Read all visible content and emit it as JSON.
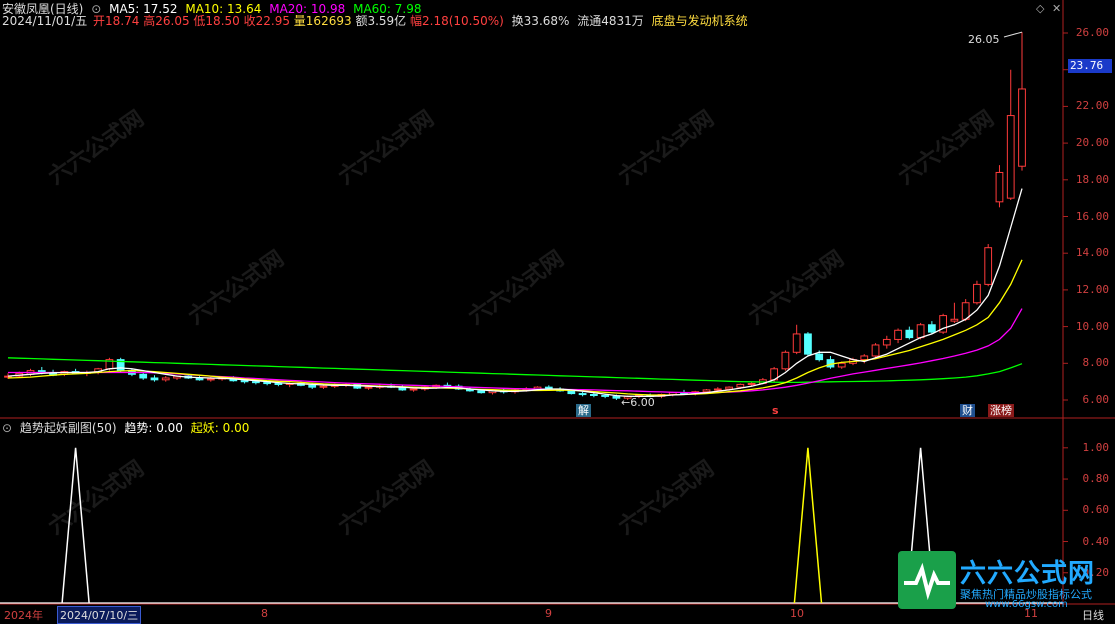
{
  "header": {
    "stock_name": "安徽凤凰(日线)",
    "ma5": "MA5: 17.52",
    "ma10": "MA10: 13.64",
    "ma20": "MA20: 10.98",
    "ma60": "MA60: 7.98",
    "date": "2024/11/01/五",
    "open": "开18.74",
    "high": "高26.05",
    "low": "低18.50",
    "close": "收22.95",
    "volume": "量162693",
    "amount": "额3.59亿",
    "change": "幅2.18(10.50%)",
    "turnover": "换33.68%",
    "float": "流通4831万",
    "system": "底盘与发动机系统"
  },
  "subchart_header": {
    "name": "趋势起妖副图(50)",
    "trend": "趋势: 0.00",
    "qiyao": "起妖: 0.00"
  },
  "price_axis": [
    "26.00",
    "24.00",
    "22.00",
    "20.00",
    "18.00",
    "16.00",
    "14.00",
    "12.00",
    "10.00",
    "8.00",
    "6.00"
  ],
  "current_price_tag": "23.76",
  "sub_axis": [
    "1.00",
    "0.80",
    "0.60",
    "0.40",
    "0.20"
  ],
  "annotations": {
    "high_label": "26.05",
    "low_label": "6.00",
    "marker_jie": "解",
    "marker_s": "s",
    "marker_cai": "财",
    "marker_zhangbang": "涨榜"
  },
  "time_axis": {
    "year": "2024年",
    "cursor_date": "2024/07/10/三",
    "m8": "8",
    "m9": "9",
    "m10": "10",
    "m11": "11",
    "period": "日线"
  },
  "watermark": {
    "brand": "六六公式网",
    "slogan": "聚焦热门精品炒股指标公式",
    "url": "www.66gsw.com",
    "wm_text": "六六公式网"
  },
  "colors": {
    "up": "#ff3b3b",
    "down": "#54ffff",
    "ma5": "#ffffff",
    "ma10": "#ffff00",
    "ma20": "#ff00ff",
    "ma60": "#00ff00",
    "axis": "#b02020"
  },
  "chart_data": {
    "type": "candlestick",
    "y_range": [
      5.4,
      26.8
    ],
    "candles": [
      [
        7.25,
        7.45,
        7.15,
        7.3
      ],
      [
        7.3,
        7.55,
        7.2,
        7.45
      ],
      [
        7.4,
        7.7,
        7.3,
        7.6
      ],
      [
        7.6,
        7.8,
        7.4,
        7.5
      ],
      [
        7.5,
        7.65,
        7.3,
        7.35
      ],
      [
        7.4,
        7.6,
        7.3,
        7.55
      ],
      [
        7.55,
        7.7,
        7.4,
        7.45
      ],
      [
        7.45,
        7.6,
        7.3,
        7.5
      ],
      [
        7.5,
        7.75,
        7.4,
        7.7
      ],
      [
        7.7,
        8.3,
        7.6,
        8.2
      ],
      [
        8.2,
        8.3,
        7.5,
        7.6
      ],
      [
        7.6,
        7.7,
        7.3,
        7.4
      ],
      [
        7.4,
        7.5,
        7.1,
        7.2
      ],
      [
        7.2,
        7.35,
        7.0,
        7.1
      ],
      [
        7.1,
        7.3,
        7.0,
        7.2
      ],
      [
        7.2,
        7.35,
        7.1,
        7.3
      ],
      [
        7.3,
        7.4,
        7.15,
        7.2
      ],
      [
        7.2,
        7.3,
        7.05,
        7.1
      ],
      [
        7.1,
        7.25,
        7.0,
        7.15
      ],
      [
        7.15,
        7.3,
        7.05,
        7.2
      ],
      [
        7.2,
        7.3,
        7.0,
        7.05
      ],
      [
        7.05,
        7.15,
        6.9,
        7.0
      ],
      [
        7.0,
        7.1,
        6.85,
        6.95
      ],
      [
        6.95,
        7.05,
        6.8,
        6.9
      ],
      [
        6.9,
        7.0,
        6.75,
        6.85
      ],
      [
        6.85,
        6.95,
        6.7,
        6.9
      ],
      [
        6.9,
        7.0,
        6.75,
        6.8
      ],
      [
        6.8,
        6.9,
        6.6,
        6.7
      ],
      [
        6.7,
        6.85,
        6.6,
        6.75
      ],
      [
        6.75,
        6.9,
        6.65,
        6.8
      ],
      [
        6.8,
        6.95,
        6.7,
        6.85
      ],
      [
        6.85,
        6.9,
        6.6,
        6.65
      ],
      [
        6.65,
        6.8,
        6.55,
        6.7
      ],
      [
        6.7,
        6.85,
        6.6,
        6.75
      ],
      [
        6.75,
        6.9,
        6.65,
        6.7
      ],
      [
        6.7,
        6.8,
        6.5,
        6.55
      ],
      [
        6.55,
        6.7,
        6.45,
        6.6
      ],
      [
        6.6,
        6.75,
        6.5,
        6.7
      ],
      [
        6.7,
        6.85,
        6.6,
        6.8
      ],
      [
        6.8,
        6.95,
        6.7,
        6.75
      ],
      [
        6.75,
        6.85,
        6.55,
        6.6
      ],
      [
        6.6,
        6.7,
        6.45,
        6.5
      ],
      [
        6.5,
        6.6,
        6.35,
        6.4
      ],
      [
        6.4,
        6.55,
        6.3,
        6.5
      ],
      [
        6.5,
        6.6,
        6.35,
        6.45
      ],
      [
        6.45,
        6.6,
        6.35,
        6.55
      ],
      [
        6.55,
        6.7,
        6.45,
        6.6
      ],
      [
        6.6,
        6.75,
        6.5,
        6.7
      ],
      [
        6.7,
        6.8,
        6.55,
        6.6
      ],
      [
        6.6,
        6.7,
        6.45,
        6.5
      ],
      [
        6.5,
        6.6,
        6.3,
        6.35
      ],
      [
        6.35,
        6.45,
        6.2,
        6.3
      ],
      [
        6.3,
        6.4,
        6.15,
        6.25
      ],
      [
        6.25,
        6.35,
        6.1,
        6.2
      ],
      [
        6.2,
        6.3,
        6.0,
        6.1
      ],
      [
        6.1,
        6.25,
        6.0,
        6.2
      ],
      [
        6.2,
        6.3,
        6.1,
        6.25
      ],
      [
        6.25,
        6.35,
        6.15,
        6.2
      ],
      [
        6.2,
        6.35,
        6.1,
        6.3
      ],
      [
        6.3,
        6.45,
        6.2,
        6.4
      ],
      [
        6.4,
        6.55,
        6.3,
        6.35
      ],
      [
        6.35,
        6.5,
        6.25,
        6.45
      ],
      [
        6.45,
        6.6,
        6.35,
        6.55
      ],
      [
        6.55,
        6.7,
        6.45,
        6.6
      ],
      [
        6.6,
        6.75,
        6.5,
        6.7
      ],
      [
        6.7,
        6.9,
        6.6,
        6.85
      ],
      [
        6.85,
        7.0,
        6.75,
        6.9
      ],
      [
        6.9,
        7.2,
        6.85,
        7.1
      ],
      [
        7.1,
        7.8,
        7.0,
        7.7
      ],
      [
        7.7,
        8.7,
        7.6,
        8.6
      ],
      [
        8.6,
        10.1,
        8.5,
        9.6
      ],
      [
        9.6,
        9.7,
        8.4,
        8.5
      ],
      [
        8.5,
        8.7,
        8.1,
        8.2
      ],
      [
        8.2,
        8.4,
        7.7,
        7.8
      ],
      [
        7.8,
        8.1,
        7.7,
        8.0
      ],
      [
        8.0,
        8.3,
        7.9,
        8.2
      ],
      [
        8.2,
        8.5,
        8.0,
        8.4
      ],
      [
        8.4,
        9.1,
        8.3,
        9.0
      ],
      [
        9.0,
        9.5,
        8.8,
        9.3
      ],
      [
        9.3,
        9.9,
        9.1,
        9.8
      ],
      [
        9.8,
        10.0,
        9.3,
        9.4
      ],
      [
        9.4,
        10.2,
        9.3,
        10.1
      ],
      [
        10.1,
        10.3,
        9.6,
        9.7
      ],
      [
        9.7,
        10.7,
        9.6,
        10.6
      ],
      [
        10.3,
        11.3,
        10.2,
        10.4
      ],
      [
        10.4,
        11.5,
        10.3,
        11.3
      ],
      [
        11.3,
        12.5,
        11.2,
        12.3
      ],
      [
        12.3,
        14.5,
        12.2,
        14.3
      ],
      [
        16.8,
        18.8,
        16.5,
        18.4
      ],
      [
        17.0,
        24.0,
        16.9,
        21.5
      ],
      [
        18.74,
        26.05,
        18.5,
        22.95
      ]
    ],
    "ma5": [
      7.3,
      7.35,
      7.4,
      7.45,
      7.48,
      7.5,
      7.5,
      7.5,
      7.55,
      7.7,
      7.75,
      7.7,
      7.6,
      7.5,
      7.4,
      7.3,
      7.25,
      7.22,
      7.2,
      7.18,
      7.15,
      7.1,
      7.05,
      7.0,
      6.95,
      6.9,
      6.88,
      6.85,
      6.82,
      6.8,
      6.8,
      6.78,
      6.75,
      6.73,
      6.72,
      6.7,
      6.66,
      6.64,
      6.65,
      6.68,
      6.66,
      6.6,
      6.55,
      6.5,
      6.47,
      6.47,
      6.5,
      6.56,
      6.6,
      6.6,
      6.55,
      6.48,
      6.4,
      6.32,
      6.24,
      6.2,
      6.2,
      6.2,
      6.22,
      6.27,
      6.3,
      6.35,
      6.4,
      6.48,
      6.55,
      6.65,
      6.75,
      6.9,
      7.1,
      7.5,
      8.0,
      8.4,
      8.6,
      8.6,
      8.4,
      8.2,
      8.1,
      8.3,
      8.5,
      8.8,
      9.1,
      9.4,
      9.6,
      9.9,
      10.1,
      10.4,
      10.9,
      11.7,
      13.3,
      15.4,
      17.52
    ],
    "ma10": [
      7.2,
      7.22,
      7.25,
      7.3,
      7.35,
      7.4,
      7.42,
      7.45,
      7.5,
      7.55,
      7.58,
      7.6,
      7.58,
      7.55,
      7.5,
      7.45,
      7.4,
      7.35,
      7.3,
      7.25,
      7.2,
      7.15,
      7.1,
      7.05,
      7.02,
      7.0,
      6.96,
      6.92,
      6.88,
      6.85,
      6.83,
      6.8,
      6.78,
      6.76,
      6.74,
      6.72,
      6.7,
      6.68,
      6.66,
      6.65,
      6.63,
      6.6,
      6.58,
      6.56,
      6.54,
      6.53,
      6.52,
      6.52,
      6.53,
      6.54,
      6.53,
      6.5,
      6.46,
      6.42,
      6.38,
      6.33,
      6.3,
      6.28,
      6.27,
      6.28,
      6.3,
      6.32,
      6.35,
      6.4,
      6.45,
      6.5,
      6.58,
      6.66,
      6.78,
      6.95,
      7.2,
      7.5,
      7.75,
      7.95,
      8.05,
      8.1,
      8.15,
      8.25,
      8.4,
      8.55,
      8.7,
      8.9,
      9.1,
      9.3,
      9.55,
      9.8,
      10.1,
      10.5,
      11.3,
      12.3,
      13.64
    ],
    "ma20": [
      7.5,
      7.5,
      7.5,
      7.5,
      7.5,
      7.5,
      7.5,
      7.5,
      7.5,
      7.5,
      7.5,
      7.5,
      7.5,
      7.48,
      7.45,
      7.42,
      7.38,
      7.34,
      7.3,
      7.27,
      7.24,
      7.2,
      7.17,
      7.14,
      7.1,
      7.07,
      7.04,
      7.01,
      6.98,
      6.95,
      6.92,
      6.9,
      6.88,
      6.86,
      6.84,
      6.82,
      6.8,
      6.78,
      6.76,
      6.74,
      6.72,
      6.7,
      6.68,
      6.66,
      6.64,
      6.62,
      6.61,
      6.6,
      6.59,
      6.58,
      6.57,
      6.56,
      6.55,
      6.53,
      6.51,
      6.5,
      6.48,
      6.46,
      6.44,
      6.42,
      6.41,
      6.4,
      6.4,
      6.41,
      6.43,
      6.46,
      6.5,
      6.55,
      6.62,
      6.7,
      6.8,
      6.92,
      7.05,
      7.18,
      7.3,
      7.42,
      7.52,
      7.62,
      7.72,
      7.82,
      7.92,
      8.02,
      8.14,
      8.26,
      8.4,
      8.55,
      8.72,
      8.95,
      9.3,
      9.9,
      10.98
    ],
    "ma60": [
      8.3,
      8.28,
      8.26,
      8.24,
      8.22,
      8.2,
      8.18,
      8.16,
      8.14,
      8.12,
      8.1,
      8.08,
      8.06,
      8.04,
      8.02,
      8.0,
      7.98,
      7.96,
      7.94,
      7.92,
      7.9,
      7.88,
      7.86,
      7.84,
      7.82,
      7.8,
      7.78,
      7.76,
      7.74,
      7.72,
      7.7,
      7.68,
      7.66,
      7.64,
      7.62,
      7.6,
      7.58,
      7.56,
      7.54,
      7.52,
      7.5,
      7.48,
      7.46,
      7.44,
      7.42,
      7.4,
      7.38,
      7.36,
      7.34,
      7.32,
      7.3,
      7.28,
      7.26,
      7.24,
      7.22,
      7.2,
      7.18,
      7.16,
      7.14,
      7.12,
      7.1,
      7.08,
      7.06,
      7.04,
      7.02,
      7.0,
      6.99,
      6.98,
      6.97,
      6.96,
      6.96,
      6.97,
      6.98,
      6.99,
      7.0,
      7.01,
      7.02,
      7.03,
      7.04,
      7.06,
      7.08,
      7.1,
      7.13,
      7.16,
      7.2,
      7.25,
      7.32,
      7.42,
      7.55,
      7.75,
      7.98
    ],
    "sub_spikes": [
      {
        "index": 6,
        "value": 1.0,
        "color": "#ffffff"
      },
      {
        "index": 71,
        "value": 1.0,
        "color": "#ffff00"
      },
      {
        "index": 81,
        "value": 1.0,
        "color": "#ffffff"
      }
    ],
    "sub_y_range": [
      0,
      1.05
    ]
  }
}
